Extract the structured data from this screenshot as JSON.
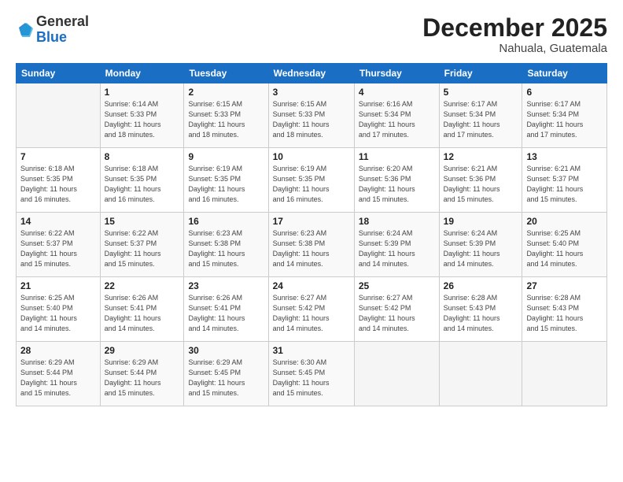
{
  "logo": {
    "general": "General",
    "blue": "Blue"
  },
  "title": "December 2025",
  "location": "Nahuala, Guatemala",
  "days_header": [
    "Sunday",
    "Monday",
    "Tuesday",
    "Wednesday",
    "Thursday",
    "Friday",
    "Saturday"
  ],
  "weeks": [
    [
      {
        "day": "",
        "info": ""
      },
      {
        "day": "1",
        "info": "Sunrise: 6:14 AM\nSunset: 5:33 PM\nDaylight: 11 hours\nand 18 minutes."
      },
      {
        "day": "2",
        "info": "Sunrise: 6:15 AM\nSunset: 5:33 PM\nDaylight: 11 hours\nand 18 minutes."
      },
      {
        "day": "3",
        "info": "Sunrise: 6:15 AM\nSunset: 5:33 PM\nDaylight: 11 hours\nand 18 minutes."
      },
      {
        "day": "4",
        "info": "Sunrise: 6:16 AM\nSunset: 5:34 PM\nDaylight: 11 hours\nand 17 minutes."
      },
      {
        "day": "5",
        "info": "Sunrise: 6:17 AM\nSunset: 5:34 PM\nDaylight: 11 hours\nand 17 minutes."
      },
      {
        "day": "6",
        "info": "Sunrise: 6:17 AM\nSunset: 5:34 PM\nDaylight: 11 hours\nand 17 minutes."
      }
    ],
    [
      {
        "day": "7",
        "info": "Sunrise: 6:18 AM\nSunset: 5:35 PM\nDaylight: 11 hours\nand 16 minutes."
      },
      {
        "day": "8",
        "info": "Sunrise: 6:18 AM\nSunset: 5:35 PM\nDaylight: 11 hours\nand 16 minutes."
      },
      {
        "day": "9",
        "info": "Sunrise: 6:19 AM\nSunset: 5:35 PM\nDaylight: 11 hours\nand 16 minutes."
      },
      {
        "day": "10",
        "info": "Sunrise: 6:19 AM\nSunset: 5:35 PM\nDaylight: 11 hours\nand 16 minutes."
      },
      {
        "day": "11",
        "info": "Sunrise: 6:20 AM\nSunset: 5:36 PM\nDaylight: 11 hours\nand 15 minutes."
      },
      {
        "day": "12",
        "info": "Sunrise: 6:21 AM\nSunset: 5:36 PM\nDaylight: 11 hours\nand 15 minutes."
      },
      {
        "day": "13",
        "info": "Sunrise: 6:21 AM\nSunset: 5:37 PM\nDaylight: 11 hours\nand 15 minutes."
      }
    ],
    [
      {
        "day": "14",
        "info": "Sunrise: 6:22 AM\nSunset: 5:37 PM\nDaylight: 11 hours\nand 15 minutes."
      },
      {
        "day": "15",
        "info": "Sunrise: 6:22 AM\nSunset: 5:37 PM\nDaylight: 11 hours\nand 15 minutes."
      },
      {
        "day": "16",
        "info": "Sunrise: 6:23 AM\nSunset: 5:38 PM\nDaylight: 11 hours\nand 15 minutes."
      },
      {
        "day": "17",
        "info": "Sunrise: 6:23 AM\nSunset: 5:38 PM\nDaylight: 11 hours\nand 14 minutes."
      },
      {
        "day": "18",
        "info": "Sunrise: 6:24 AM\nSunset: 5:39 PM\nDaylight: 11 hours\nand 14 minutes."
      },
      {
        "day": "19",
        "info": "Sunrise: 6:24 AM\nSunset: 5:39 PM\nDaylight: 11 hours\nand 14 minutes."
      },
      {
        "day": "20",
        "info": "Sunrise: 6:25 AM\nSunset: 5:40 PM\nDaylight: 11 hours\nand 14 minutes."
      }
    ],
    [
      {
        "day": "21",
        "info": "Sunrise: 6:25 AM\nSunset: 5:40 PM\nDaylight: 11 hours\nand 14 minutes."
      },
      {
        "day": "22",
        "info": "Sunrise: 6:26 AM\nSunset: 5:41 PM\nDaylight: 11 hours\nand 14 minutes."
      },
      {
        "day": "23",
        "info": "Sunrise: 6:26 AM\nSunset: 5:41 PM\nDaylight: 11 hours\nand 14 minutes."
      },
      {
        "day": "24",
        "info": "Sunrise: 6:27 AM\nSunset: 5:42 PM\nDaylight: 11 hours\nand 14 minutes."
      },
      {
        "day": "25",
        "info": "Sunrise: 6:27 AM\nSunset: 5:42 PM\nDaylight: 11 hours\nand 14 minutes."
      },
      {
        "day": "26",
        "info": "Sunrise: 6:28 AM\nSunset: 5:43 PM\nDaylight: 11 hours\nand 14 minutes."
      },
      {
        "day": "27",
        "info": "Sunrise: 6:28 AM\nSunset: 5:43 PM\nDaylight: 11 hours\nand 15 minutes."
      }
    ],
    [
      {
        "day": "28",
        "info": "Sunrise: 6:29 AM\nSunset: 5:44 PM\nDaylight: 11 hours\nand 15 minutes."
      },
      {
        "day": "29",
        "info": "Sunrise: 6:29 AM\nSunset: 5:44 PM\nDaylight: 11 hours\nand 15 minutes."
      },
      {
        "day": "30",
        "info": "Sunrise: 6:29 AM\nSunset: 5:45 PM\nDaylight: 11 hours\nand 15 minutes."
      },
      {
        "day": "31",
        "info": "Sunrise: 6:30 AM\nSunset: 5:45 PM\nDaylight: 11 hours\nand 15 minutes."
      },
      {
        "day": "",
        "info": ""
      },
      {
        "day": "",
        "info": ""
      },
      {
        "day": "",
        "info": ""
      }
    ]
  ]
}
